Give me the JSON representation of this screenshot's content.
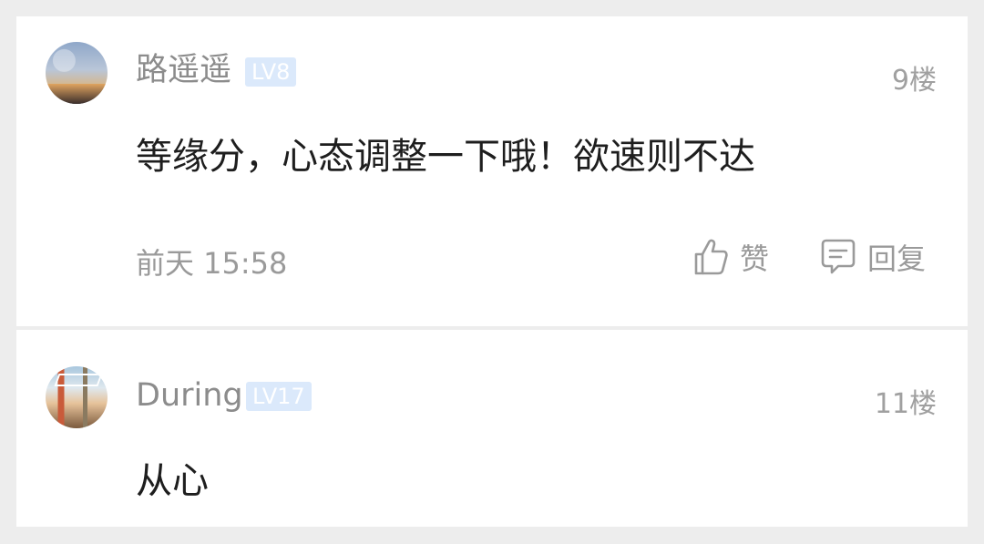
{
  "comments": [
    {
      "username": "路遥遥",
      "level": "LV8",
      "floor": "9楼",
      "content": "等缘分，心态调整一下哦！欲速则不达",
      "timestamp": "前天 15:58",
      "like_label": "赞",
      "reply_label": "回复"
    },
    {
      "username": "During",
      "level": "LV17",
      "floor": "11楼",
      "content": "从心"
    }
  ],
  "colors": {
    "page_background": "#ededed",
    "card_background": "#ffffff",
    "username": "#8c8c8c",
    "level_badge": "#dbe9fb",
    "content_text": "#1e1e1e",
    "meta_text": "#9a9a9a"
  },
  "icons": {
    "like": "thumbs-up-icon",
    "reply": "comment-bubble-icon"
  }
}
